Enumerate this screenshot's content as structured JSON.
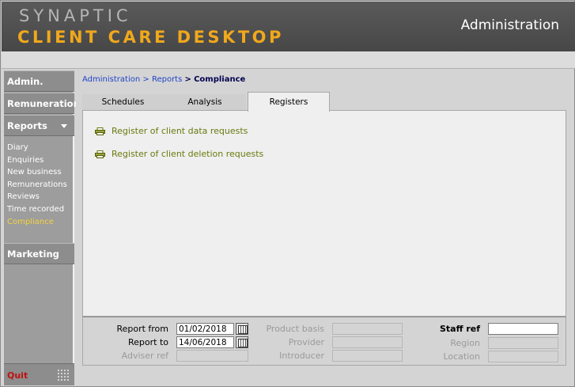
{
  "header": {
    "logo_line1": "SYNAPTIC",
    "logo_line2": "CLIENT CARE DESKTOP",
    "section_title": "Administration"
  },
  "sidebar": {
    "admin": "Admin.",
    "remuneration": "Remuneration",
    "reports": "Reports",
    "report_items": [
      "Diary",
      "Enquiries",
      "New business",
      "Remunerations",
      "Reviews",
      "Time recorded",
      "Compliance"
    ],
    "active_item": "Compliance",
    "marketing": "Marketing",
    "quit": "Quit"
  },
  "breadcrumb": {
    "items": [
      "Administration",
      "Reports"
    ],
    "separator": ">",
    "current": "Compliance"
  },
  "tabs": [
    {
      "label": "Schedules"
    },
    {
      "label": "Analysis"
    },
    {
      "label": "Registers",
      "active": true
    }
  ],
  "reports": [
    {
      "label": "Register of client data requests",
      "icon": "printer-icon"
    },
    {
      "label": "Register of client deletion requests",
      "icon": "printer-icon"
    }
  ],
  "filters": {
    "report_from_label": "Report from",
    "report_from_value": "01/02/2018",
    "report_to_label": "Report to",
    "report_to_value": "14/06/2018",
    "adviser_ref_label": "Adviser ref",
    "product_basis_label": "Product basis",
    "provider_label": "Provider",
    "introducer_label": "Introducer",
    "staff_ref_label": "Staff ref",
    "staff_ref_value": "",
    "region_label": "Region",
    "location_label": "Location"
  },
  "colors": {
    "header_bg": "#4d4d4d",
    "logo_accent": "#f0a81c",
    "sidebar_bg": "#9d9d9d",
    "active_item": "#f4d23c",
    "link": "#1f44c8",
    "report_link": "#6b7a0e",
    "quit": "#c01010"
  }
}
